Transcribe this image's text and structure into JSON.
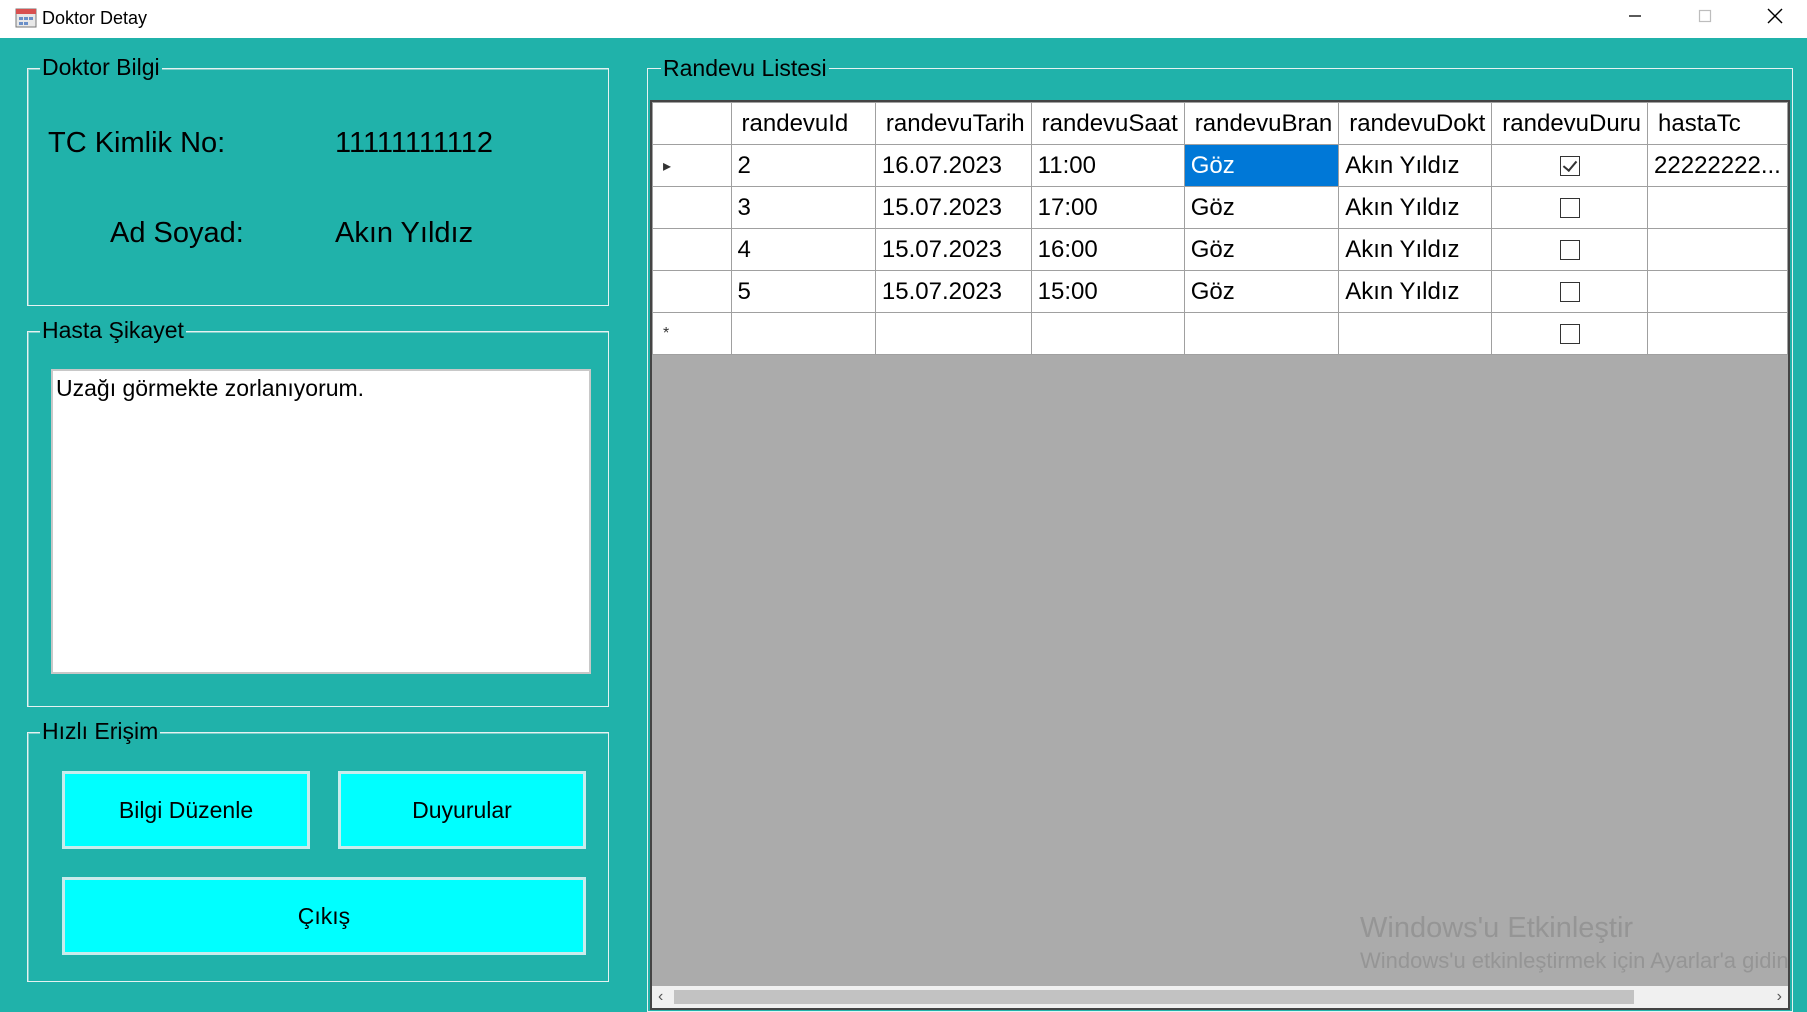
{
  "window": {
    "title": "Doktor Detay",
    "controls": {
      "minimize": "—",
      "maximize": "☐",
      "close": "✕"
    }
  },
  "doktor_bilgi": {
    "title": "Doktor Bilgi",
    "tc_label": "TC Kimlik No:",
    "tc_value": "11111111112",
    "name_label": "Ad Soyad:",
    "name_value": "Akın Yıldız"
  },
  "hasta_sikayet": {
    "title": "Hasta Şikayet",
    "text": "Uzağı görmekte zorlanıyorum."
  },
  "hizli_erisim": {
    "title": "Hızlı Erişim",
    "edit_button": "Bilgi Düzenle",
    "announcements_button": "Duyurular",
    "exit_button": "Çıkış"
  },
  "randevu_listesi": {
    "title": "Randevu Listesi",
    "columns": [
      "randevuId",
      "randevuTarih",
      "randevuSaat",
      "randevuBran",
      "randevuDokt",
      "randevuDuru",
      "hastaTc"
    ],
    "rows": [
      {
        "id": "2",
        "tarih": "16.07.2023",
        "saat": "11:00",
        "brans": "Göz",
        "doktor": "Akın Yıldız",
        "durum": true,
        "hastaTc": "22222222..."
      },
      {
        "id": "3",
        "tarih": "15.07.2023",
        "saat": "17:00",
        "brans": "Göz",
        "doktor": "Akın Yıldız",
        "durum": false,
        "hastaTc": ""
      },
      {
        "id": "4",
        "tarih": "15.07.2023",
        "saat": "16:00",
        "brans": "Göz",
        "doktor": "Akın Yıldız",
        "durum": false,
        "hastaTc": ""
      },
      {
        "id": "5",
        "tarih": "15.07.2023",
        "saat": "15:00",
        "brans": "Göz",
        "doktor": "Akın Yıldız",
        "durum": false,
        "hastaTc": ""
      }
    ],
    "current_row_marker": "▸",
    "new_row_marker": "*",
    "selected_cell": "Göz"
  },
  "watermark": {
    "line1": "Windows'u Etkinleştir",
    "line2": "Windows'u etkinleştirmek için Ayarlar'a gidin."
  },
  "colors": {
    "background": "#20b2aa",
    "button": "#00ffff",
    "selection": "#0078d7",
    "grid_empty": "#ababab"
  },
  "icons": [
    "app-icon",
    "minimize-icon",
    "maximize-icon",
    "close-icon",
    "scroll-left-icon",
    "scroll-right-icon"
  ]
}
